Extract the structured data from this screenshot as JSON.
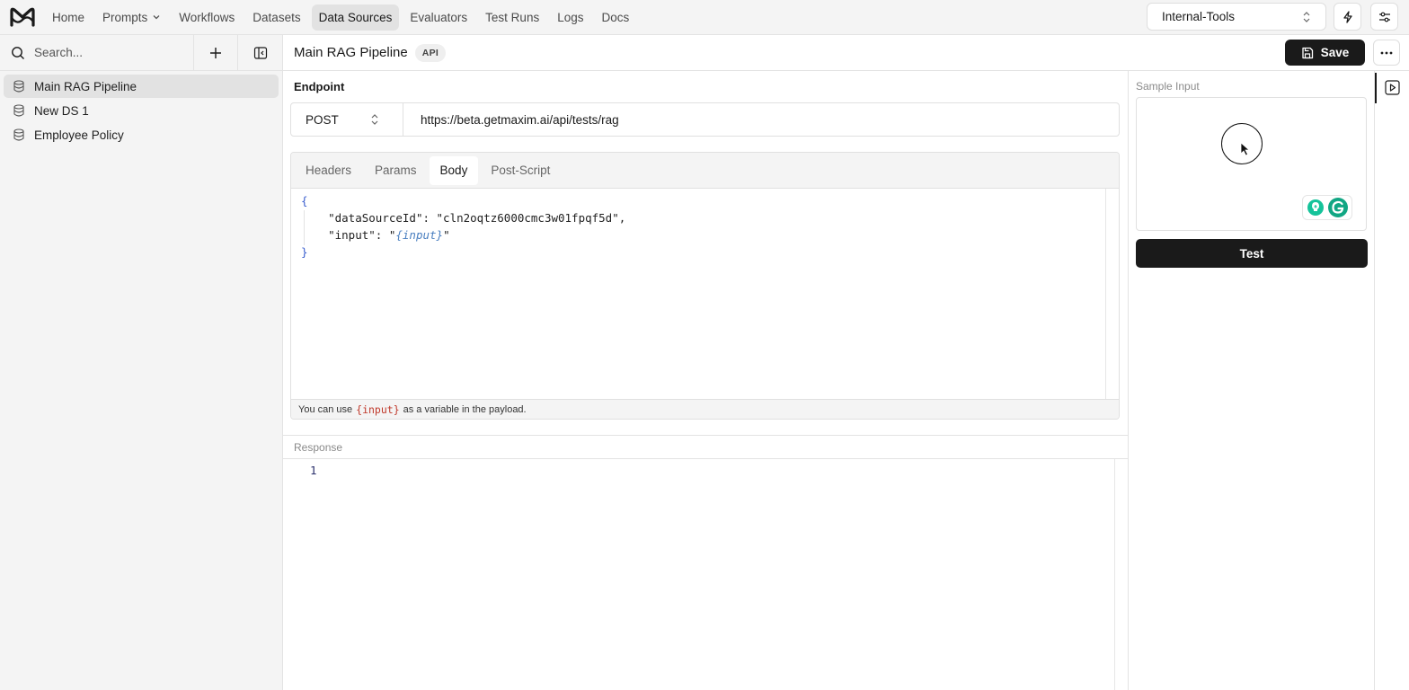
{
  "nav": {
    "items": [
      {
        "label": "Home"
      },
      {
        "label": "Prompts"
      },
      {
        "label": "Workflows"
      },
      {
        "label": "Datasets"
      },
      {
        "label": "Data Sources"
      },
      {
        "label": "Evaluators"
      },
      {
        "label": "Test Runs"
      },
      {
        "label": "Logs"
      },
      {
        "label": "Docs"
      }
    ],
    "active": "Data Sources",
    "workspace": "Internal-Tools"
  },
  "sidebar": {
    "search_placeholder": "Search...",
    "items": [
      {
        "label": "Main RAG Pipeline",
        "active": true
      },
      {
        "label": "New DS 1",
        "active": false
      },
      {
        "label": "Employee Policy",
        "active": false
      }
    ]
  },
  "header": {
    "title": "Main RAG Pipeline",
    "badge": "API",
    "save_label": "Save"
  },
  "endpoint": {
    "label": "Endpoint",
    "method": "POST",
    "url": "https://beta.getmaxim.ai/api/tests/rag"
  },
  "editor": {
    "tabs": [
      {
        "label": "Headers"
      },
      {
        "label": "Params"
      },
      {
        "label": "Body"
      },
      {
        "label": "Post-Script"
      }
    ],
    "active_tab": "Body",
    "body": {
      "open_brace": "{",
      "line1_key": "\"dataSourceId\": ",
      "line1_value": "\"cln2oqtz6000cmc3w01fpqf5d\",",
      "line2_key": "\"input\": \"",
      "line2_var": "{input}",
      "line2_end": "\"",
      "close_brace": "}"
    },
    "hint_prefix": "You can use",
    "hint_var": "{input}",
    "hint_suffix": "as a variable in the payload."
  },
  "response": {
    "label": "Response",
    "line_number": "1"
  },
  "sample": {
    "label": "Sample Input",
    "test_label": "Test"
  },
  "colors": {
    "accent_dark": "#1a1a1a",
    "brace": "#3b5fcf",
    "hint_var": "#c0392b",
    "grammarly_green": "#15c39a"
  }
}
